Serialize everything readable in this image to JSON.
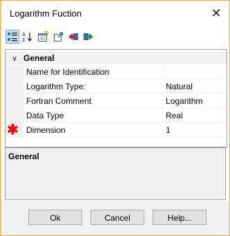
{
  "window": {
    "title": "Logarithm Fuction",
    "close_glyph": "✕"
  },
  "toolbar": {
    "buttons": [
      {
        "name": "categorized-view-icon",
        "active": true
      },
      {
        "name": "alphabetical-sort-icon",
        "active": false
      },
      {
        "name": "property-pages-icon",
        "active": false
      },
      {
        "name": "export-icon",
        "active": false
      },
      {
        "name": "import-red-icon",
        "active": false
      },
      {
        "name": "import-green-icon",
        "active": false
      }
    ]
  },
  "grid": {
    "category": {
      "label": "General",
      "toggle": "∨"
    },
    "rows": [
      {
        "name": "Name for Identification",
        "value": "",
        "required": false
      },
      {
        "name": "Logarithm Type:",
        "value": "Natural",
        "required": false
      },
      {
        "name": "Fortran Comment",
        "value": "Logarithm",
        "required": false
      },
      {
        "name": "Data Type",
        "value": "Real",
        "required": false
      },
      {
        "name": "Dimension",
        "value": "1",
        "required": true
      }
    ]
  },
  "description": {
    "title": "General"
  },
  "buttons": {
    "ok": "Ok",
    "cancel": "Cancel",
    "help": "Help..."
  },
  "colors": {
    "window_border": "#f0a34a",
    "required_marker": "#e01010",
    "panel_bg": "#f0f0f0"
  }
}
